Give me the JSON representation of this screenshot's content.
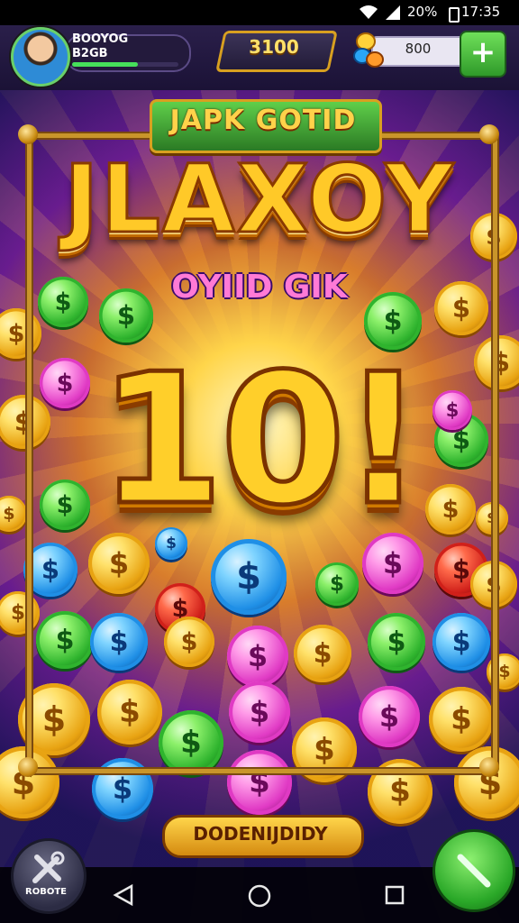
{
  "status_bar": {
    "battery": "20%",
    "time": "17:35"
  },
  "hud": {
    "player_name": "BOOYOG",
    "player_sub": "B2GB",
    "xp_progress": 0.62,
    "top_badge": "3100",
    "coin_value": "800",
    "add_button": "+"
  },
  "banner": {
    "plate": "JAPK GOTID"
  },
  "title": "JLAXOY",
  "subtitle": "OYIID GIK",
  "big_number": "10!",
  "bottom_plate": "DODENIJDIDY",
  "settings_label": "ROBOTE",
  "colors": {
    "gold": "#ffc928",
    "green": "#3fcf45",
    "frame": "#c9952a",
    "magenta": "#ff59d6",
    "blue": "#2aa6f5"
  },
  "icons": [
    "avatar-portrait",
    "coin-stack-icon",
    "plus-icon",
    "tools-icon",
    "checkmark-icon",
    "back-icon",
    "home-icon",
    "recents-icon",
    "wifi-icon",
    "signal-icon"
  ]
}
